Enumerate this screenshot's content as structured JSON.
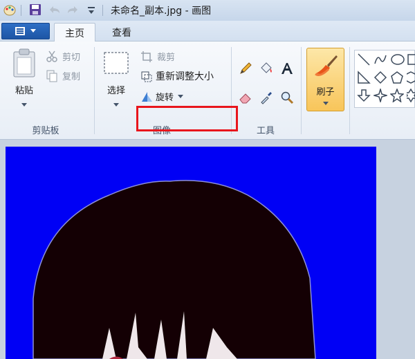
{
  "window": {
    "title": "未命名_副本.jpg - 画图"
  },
  "tabs": {
    "home": "主页",
    "view": "查看"
  },
  "clipboard": {
    "paste": "粘贴",
    "cut": "剪切",
    "copy": "复制",
    "group_label": "剪贴板"
  },
  "image": {
    "select": "选择",
    "crop": "裁剪",
    "resize": "重新调整大小",
    "rotate": "旋转",
    "group_label": "图像"
  },
  "tools": {
    "group_label": "工具"
  },
  "brushes": {
    "label": "刷子"
  },
  "colors": {
    "canvas_background": "#0000f5",
    "hair": "#140004",
    "highlight": "#e8151c"
  }
}
